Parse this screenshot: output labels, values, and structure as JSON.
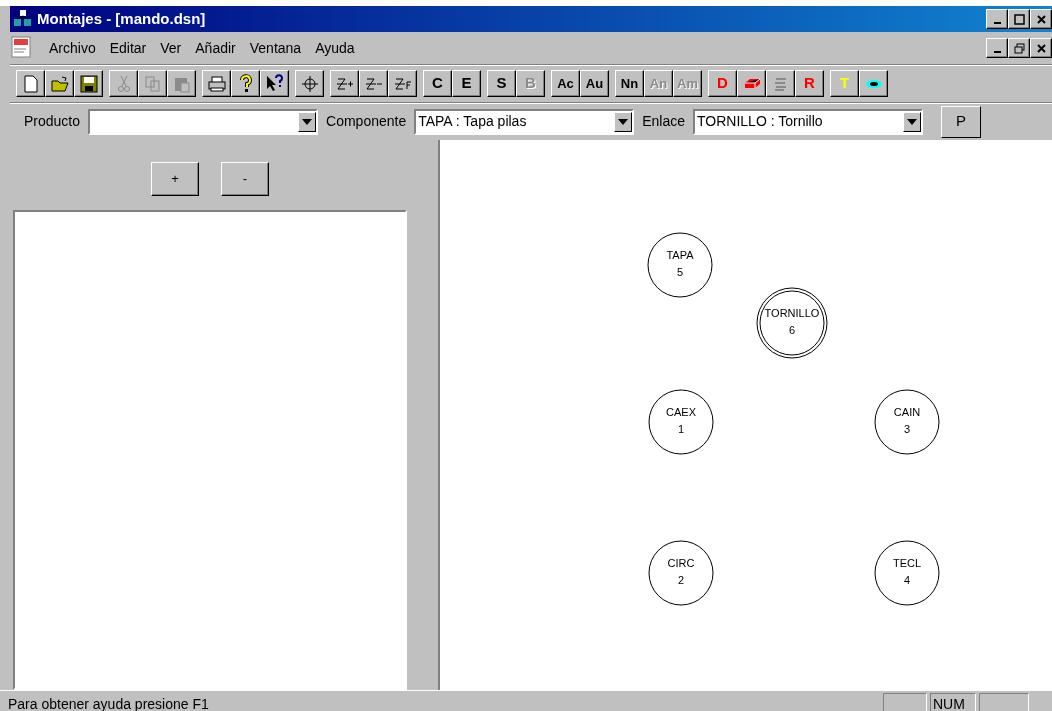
{
  "window": {
    "title": "Montajes - [mando.dsn]"
  },
  "menu": [
    {
      "label": "Archivo"
    },
    {
      "label": "Editar"
    },
    {
      "label": "Ver"
    },
    {
      "label": "Añadir"
    },
    {
      "label": "Ventana"
    },
    {
      "label": "Ayuda"
    }
  ],
  "toolbar": [
    [
      {
        "kind": "icon",
        "disabled": false
      },
      {
        "kind": "icon",
        "disabled": false
      },
      {
        "kind": "icon",
        "disabled": false
      }
    ],
    [
      {
        "kind": "icon",
        "disabled": true
      },
      {
        "kind": "icon",
        "disabled": true
      },
      {
        "kind": "icon",
        "disabled": true
      }
    ],
    [
      {
        "kind": "icon",
        "disabled": false
      },
      {
        "kind": "icon",
        "disabled": false
      },
      {
        "kind": "icon",
        "disabled": false
      }
    ],
    [
      {
        "kind": "icon",
        "disabled": false
      }
    ],
    [
      {
        "kind": "icon",
        "disabled": false
      },
      {
        "kind": "icon",
        "disabled": false
      },
      {
        "kind": "icon",
        "disabled": false
      }
    ],
    [
      {
        "kind": "text",
        "label": "C",
        "disabled": false,
        "color": "#000000"
      },
      {
        "kind": "text",
        "label": "E",
        "disabled": false,
        "color": "#000000"
      }
    ],
    [
      {
        "kind": "text",
        "label": "S",
        "disabled": false,
        "color": "#000000"
      },
      {
        "kind": "text",
        "label": "B",
        "disabled": true,
        "color": "#000000"
      }
    ],
    [
      {
        "kind": "text",
        "label": "Ac",
        "disabled": false,
        "color": "#000000"
      },
      {
        "kind": "text",
        "label": "Au",
        "disabled": false,
        "color": "#000000"
      }
    ],
    [
      {
        "kind": "text",
        "label": "Nn",
        "disabled": false,
        "color": "#000000"
      },
      {
        "kind": "text",
        "label": "An",
        "disabled": true,
        "color": "#000000"
      },
      {
        "kind": "text",
        "label": "Am",
        "disabled": true,
        "color": "#000000"
      }
    ],
    [
      {
        "kind": "text",
        "label": "D",
        "disabled": false,
        "color": "#ff0000"
      },
      {
        "kind": "icon",
        "disabled": false
      },
      {
        "kind": "icon",
        "disabled": true
      },
      {
        "kind": "text",
        "label": "R",
        "disabled": false,
        "color": "#ff0000"
      }
    ],
    [
      {
        "kind": "text",
        "label": "T",
        "disabled": false,
        "color": "#ffff00"
      },
      {
        "kind": "icon",
        "disabled": false
      }
    ]
  ],
  "selectors": [
    {
      "label": "Producto"
    },
    {
      "label": "Componente",
      "value": "TAPA : Tapa pilas"
    },
    {
      "label": "Enlace",
      "value": "TORNILLO : Tornillo"
    }
  ],
  "p_button": "P",
  "tree_buttons": [
    "+",
    "-"
  ],
  "nodes": [
    {
      "name": "TAPA",
      "number": "5",
      "selected": false
    },
    {
      "name": "TORNILLO",
      "number": "6",
      "selected": true
    },
    {
      "name": "CAEX",
      "number": "1",
      "selected": false
    },
    {
      "name": "CAIN",
      "number": "3",
      "selected": false
    },
    {
      "name": "CIRC",
      "number": "2",
      "selected": false
    },
    {
      "name": "TECL",
      "number": "4",
      "selected": false
    }
  ],
  "status_bar": {
    "message": "Para obtener ayuda presione F1",
    "indicator": "NUM"
  }
}
